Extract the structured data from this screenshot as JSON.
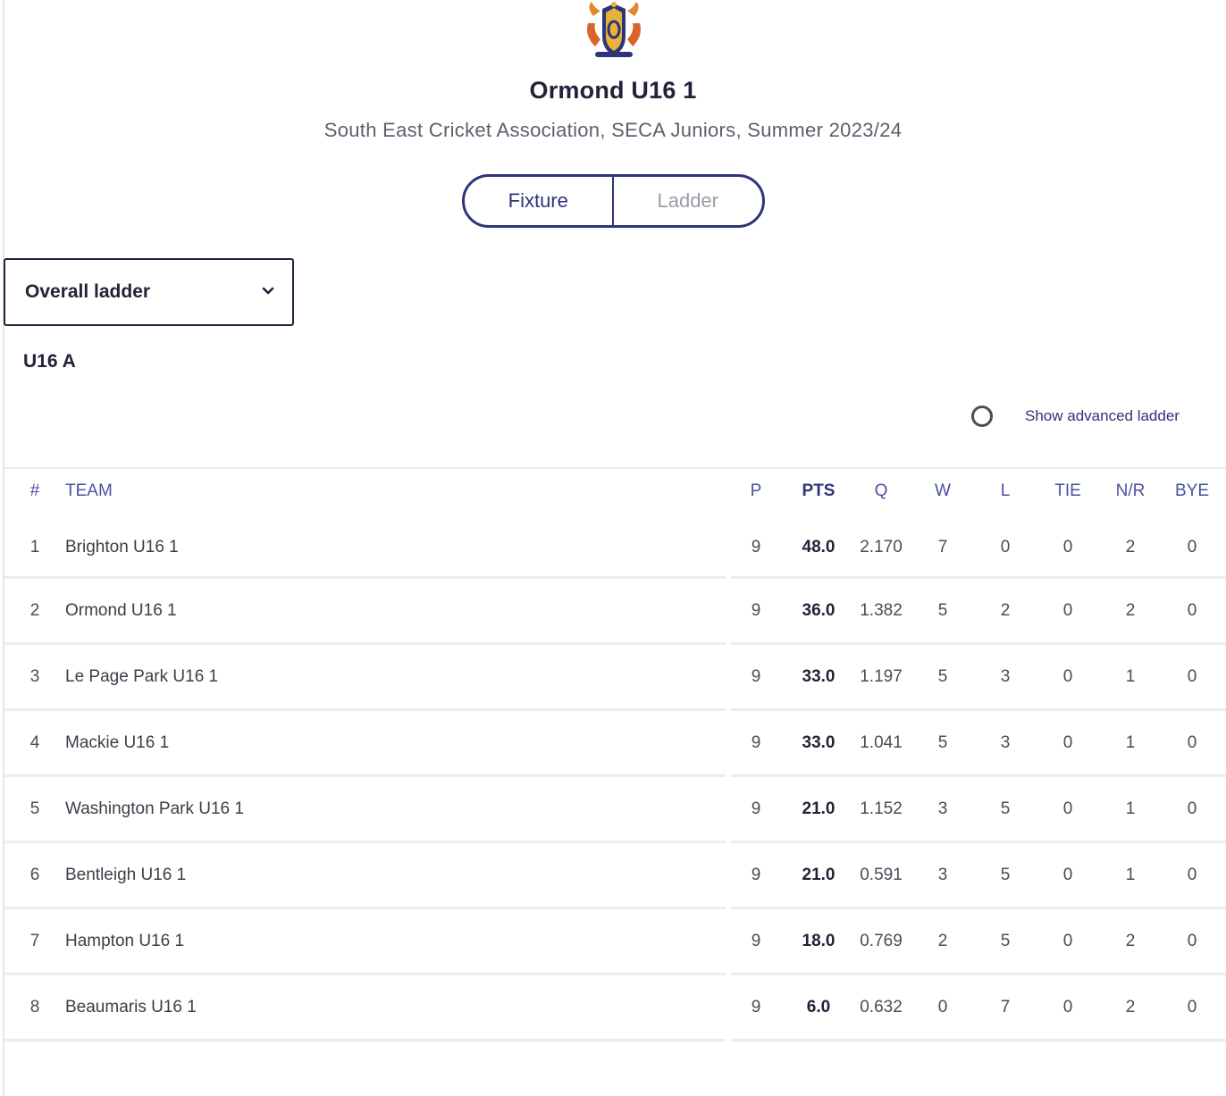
{
  "header": {
    "team_name": "Ormond U16 1",
    "competition": "South East Cricket Association, SECA Juniors, Summer 2023/24",
    "logo_icon": "club-crest-icon"
  },
  "tabs": [
    {
      "label": "Fixture",
      "active": true
    },
    {
      "label": "Ladder",
      "active": false
    }
  ],
  "ladder_select": {
    "value": "Overall ladder"
  },
  "group": {
    "title": "U16 A"
  },
  "advanced_toggle": {
    "label": "Show advanced ladder",
    "checked": false
  },
  "colors": {
    "accent": "#2e3478",
    "text": "#22223a",
    "muted": "#9a9ca6"
  },
  "table": {
    "headers": {
      "rank": "#",
      "team": "TEAM",
      "p": "P",
      "pts": "PTS",
      "q": "Q",
      "w": "W",
      "l": "L",
      "tie": "TIE",
      "nr": "N/R",
      "bye": "BYE"
    },
    "rows": [
      {
        "rank": "1",
        "team": "Brighton U16 1",
        "p": "9",
        "pts": "48.0",
        "q": "2.170",
        "w": "7",
        "l": "0",
        "tie": "0",
        "nr": "2",
        "bye": "0"
      },
      {
        "rank": "2",
        "team": "Ormond U16 1",
        "p": "9",
        "pts": "36.0",
        "q": "1.382",
        "w": "5",
        "l": "2",
        "tie": "0",
        "nr": "2",
        "bye": "0"
      },
      {
        "rank": "3",
        "team": "Le Page Park U16 1",
        "p": "9",
        "pts": "33.0",
        "q": "1.197",
        "w": "5",
        "l": "3",
        "tie": "0",
        "nr": "1",
        "bye": "0"
      },
      {
        "rank": "4",
        "team": "Mackie U16 1",
        "p": "9",
        "pts": "33.0",
        "q": "1.041",
        "w": "5",
        "l": "3",
        "tie": "0",
        "nr": "1",
        "bye": "0"
      },
      {
        "rank": "5",
        "team": "Washington Park U16 1",
        "p": "9",
        "pts": "21.0",
        "q": "1.152",
        "w": "3",
        "l": "5",
        "tie": "0",
        "nr": "1",
        "bye": "0"
      },
      {
        "rank": "6",
        "team": "Bentleigh U16 1",
        "p": "9",
        "pts": "21.0",
        "q": "0.591",
        "w": "3",
        "l": "5",
        "tie": "0",
        "nr": "1",
        "bye": "0"
      },
      {
        "rank": "7",
        "team": "Hampton U16 1",
        "p": "9",
        "pts": "18.0",
        "q": "0.769",
        "w": "2",
        "l": "5",
        "tie": "0",
        "nr": "2",
        "bye": "0"
      },
      {
        "rank": "8",
        "team": "Beaumaris U16 1",
        "p": "9",
        "pts": "6.0",
        "q": "0.632",
        "w": "0",
        "l": "7",
        "tie": "0",
        "nr": "2",
        "bye": "0"
      }
    ]
  }
}
